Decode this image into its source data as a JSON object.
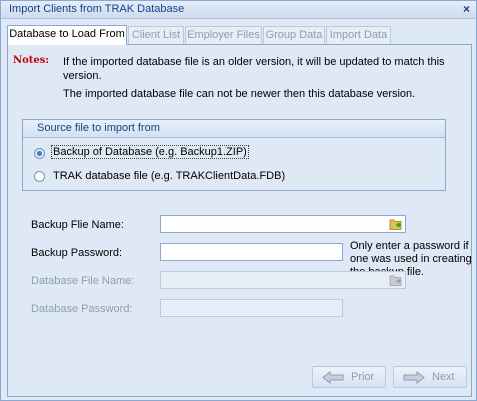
{
  "window": {
    "title": "Import Clients from TRAK Database",
    "close_glyph": "×"
  },
  "tabs": [
    {
      "label": "Database to Load From",
      "active": true
    },
    {
      "label": "Client List"
    },
    {
      "label": "Employer Files"
    },
    {
      "label": "Group Data"
    },
    {
      "label": "Import Data"
    }
  ],
  "notes": {
    "label": "Notes:",
    "line1": "If the imported database file is an older version, it will be updated to match this version.",
    "line2": "The imported database file can not be newer then this database version."
  },
  "source": {
    "title": "Source file to import from",
    "options": [
      {
        "label": "Backup of Database (e.g. Backup1.ZIP)",
        "selected": true
      },
      {
        "label": "TRAK database file (e.g. TRAKClientData.FDB)",
        "selected": false
      }
    ]
  },
  "fields": {
    "backup_file_name": {
      "label": "Backup Flie Name:",
      "value": ""
    },
    "backup_password": {
      "label": "Backup Password:",
      "value": ""
    },
    "password_hint": "Only enter a password if one was used in creating the backup file.",
    "database_file_name": {
      "label": "Database File Name:",
      "value": "",
      "disabled": true
    },
    "database_password": {
      "label": "Database Password:",
      "value": "",
      "disabled": true
    }
  },
  "buttons": {
    "prior": "Prior",
    "next": "Next"
  },
  "colors": {
    "accent": "#15428b",
    "notes_red": "#c00000",
    "folder_green": "#3c9a2a"
  }
}
